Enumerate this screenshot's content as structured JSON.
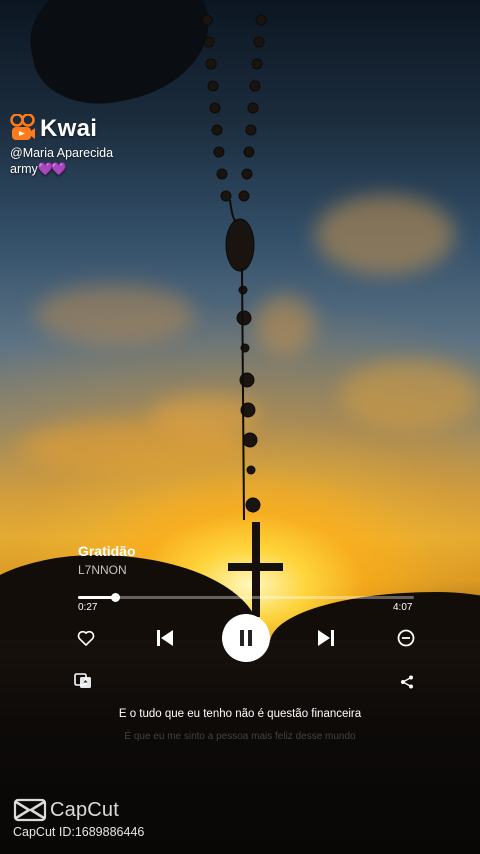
{
  "watermark": {
    "brand": "Kwai",
    "handle": "@Maria Aparecida",
    "subtitle": "army",
    "subtitle_hearts": "💜💜"
  },
  "player": {
    "song_title": "Gratidão",
    "artist": "L7NNON",
    "current_time": "0:27",
    "total_time": "4:07",
    "progress": 0.11
  },
  "lyrics": {
    "current_line": "E o tudo que eu tenho não é questão financeira",
    "next_line": "É que eu me sinto a pessoa mais feliz desse mundo"
  },
  "capcut": {
    "brand": "CapCut",
    "id_text": "CapCut ID:1689886446"
  },
  "icons": {
    "like": "heart-icon",
    "prev": "skip-previous-icon",
    "pause": "pause-icon",
    "next": "skip-next-icon",
    "remove": "minus-circle-icon",
    "template": "template-icon",
    "share": "share-icon"
  },
  "colors": {
    "kwai_orange": "#ff7a1a",
    "hearts": "#9b37ff"
  }
}
